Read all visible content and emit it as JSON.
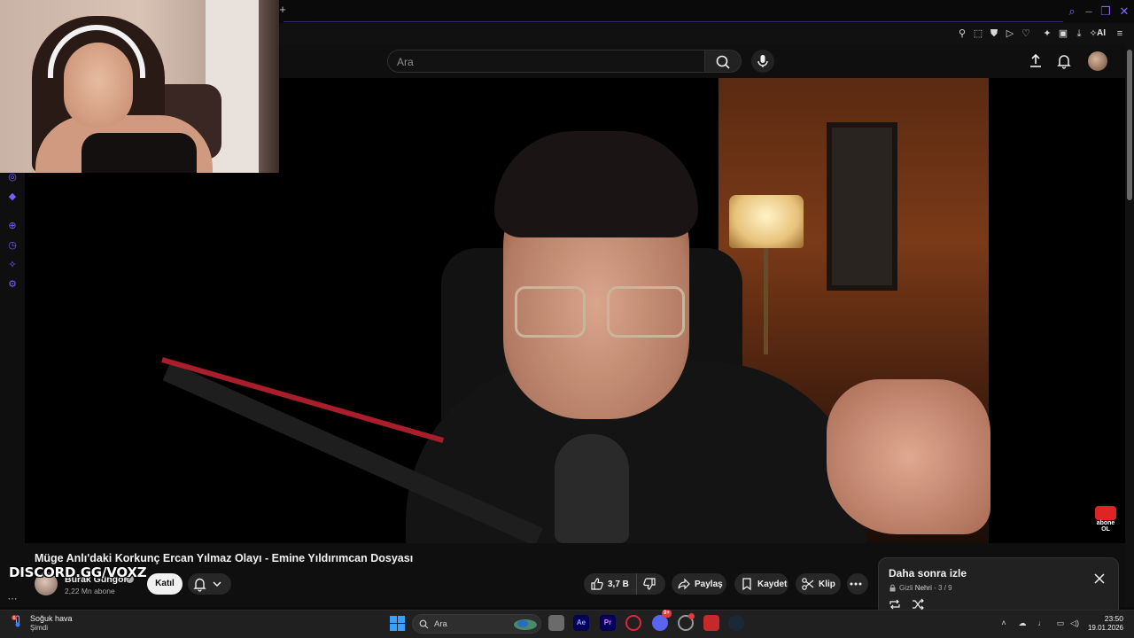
{
  "browser": {
    "new_tab": "+",
    "toolbar_ai": "AI"
  },
  "youtube": {
    "search": {
      "placeholder": "Ara"
    },
    "video": {
      "title": "Müge Anlı'daki Korkunç Ercan Yılmaz Olayı - Emine Yıldırımcan Dosyası",
      "overlay_logo": {
        "line1": "abone",
        "line2": "OL"
      }
    },
    "channel": {
      "name": "Burak Güngör",
      "subscribers": "2,22 Mn abone",
      "join_label": "Katıl"
    },
    "actions": {
      "likes": "3,7 B",
      "share": "Paylaş",
      "save": "Kaydet",
      "clip": "Klip"
    },
    "watch_later": {
      "title": "Daha sonra izle",
      "privacy": "Gizli",
      "owner": "Nehri",
      "position": "3 / 9"
    }
  },
  "stream_overlay": {
    "discord_tag": "DISCORD.GG/VOXZ"
  },
  "taskbar": {
    "weather_title": "Soğuk hava",
    "weather_sub": "Şimdi",
    "weather_badge": "6",
    "search_label": "Ara",
    "apps": [
      {
        "name": "ae",
        "label": "Ae",
        "color": "#00005b",
        "text_color": "#9999ff"
      },
      {
        "name": "pr",
        "label": "Pr",
        "color": "#00005b",
        "text_color": "#ea77ff"
      }
    ],
    "discord_badge": "9+",
    "time": "23:50",
    "date": "19.01.2026"
  },
  "colors": {
    "accent_purple": "#7b5cff",
    "yt_red": "#e02424"
  }
}
